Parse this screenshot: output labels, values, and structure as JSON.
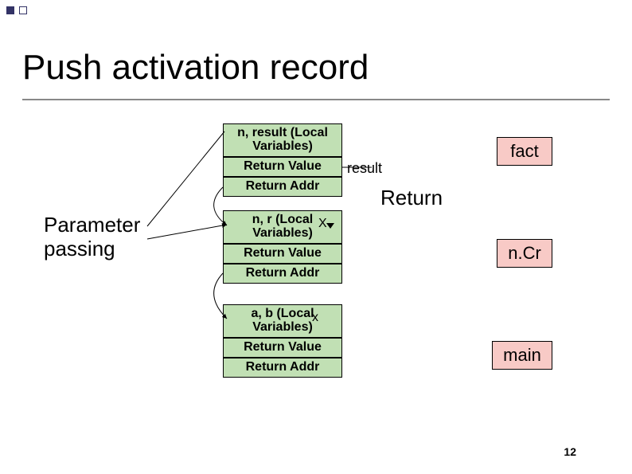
{
  "title": "Push activation record",
  "page_number": "12",
  "side": {
    "param": "Parameter\npassing",
    "return": "Return"
  },
  "stack": {
    "frame_top": {
      "locals": "n, result (Local\nVariables)",
      "retval": "Return Value",
      "retaddr": "Return Addr",
      "result_annot": "result"
    },
    "frame_mid": {
      "locals": "n, r (Local\nVariables)",
      "retval": "Return Value",
      "retaddr": "Return Addr",
      "x_annot": "X"
    },
    "frame_bot": {
      "locals": "a, b (Local\nVariables)",
      "retval": "Return Value",
      "retaddr": "Return Addr",
      "x_annot": "x"
    }
  },
  "calls": {
    "fact": "fact",
    "ncr": "n.Cr",
    "main": "main"
  }
}
